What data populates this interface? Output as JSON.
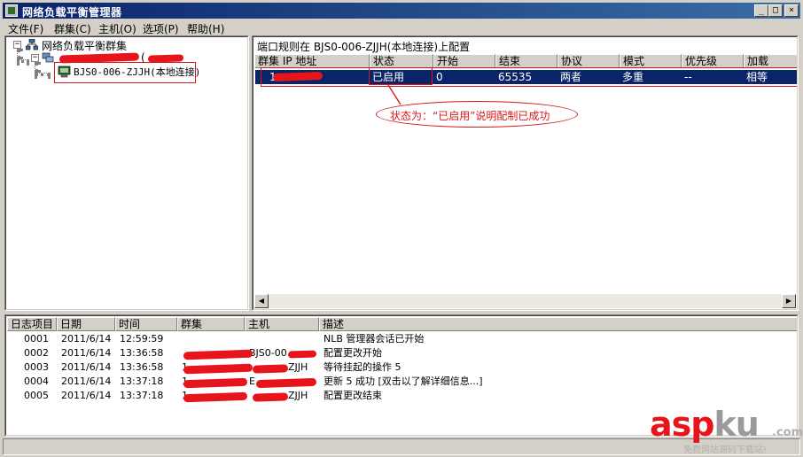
{
  "window": {
    "title": "网络负载平衡管理器",
    "controls": {
      "minimize": "_",
      "maximize": "□",
      "close": "×"
    }
  },
  "menu": [
    "文件(F)",
    "群集(C)",
    "主机(O)",
    "选项(P)",
    "帮助(H)"
  ],
  "tree": {
    "root_label": "网络负载平衡群集",
    "cluster_label_suffix": "(",
    "host_label": "BJS0-006-ZJJH(本地连接)",
    "icons": {
      "root": "network-clusters-icon",
      "cluster": "cluster-icon",
      "host": "host-computer-icon"
    }
  },
  "ports": {
    "caption": "端口规则在 BJS0-006-ZJJH(本地连接)上配置",
    "columns": [
      "群集 IP 地址",
      "状态",
      "开始",
      "结束",
      "协议",
      "模式",
      "优先级",
      "加载"
    ],
    "rows": [
      {
        "ip": "1",
        "status": "已启用",
        "start": "0",
        "end": "65535",
        "protocol": "两者",
        "mode": "多重",
        "priority": "--",
        "load": "相等"
      }
    ]
  },
  "annotation": {
    "text": "状态为：“已启用”说明配制已成功",
    "color": "#d81818"
  },
  "log": {
    "columns": [
      "日志项目",
      "日期",
      "时间",
      "群集",
      "主机",
      "描述"
    ],
    "rows": [
      {
        "id": "0001",
        "date": "2011/6/14",
        "time": "12:59:59",
        "cluster": "",
        "host": "",
        "desc": "NLB 管理器会话已开始"
      },
      {
        "id": "0002",
        "date": "2011/6/14",
        "time": "13:36:58",
        "cluster": "",
        "host": "BJS0-00",
        "desc": "配置更改开始"
      },
      {
        "id": "0003",
        "date": "2011/6/14",
        "time": "13:36:58",
        "cluster": "1",
        "host": "ZJJH",
        "desc": "等待挂起的操作 5"
      },
      {
        "id": "0004",
        "date": "2011/6/14",
        "time": "13:37:18",
        "cluster": "1",
        "host": "E",
        "desc": "更新 5 成功 [双击以了解详细信息...]"
      },
      {
        "id": "0005",
        "date": "2011/6/14",
        "time": "13:37:18",
        "cluster": "1",
        "host": "ZJJH",
        "desc": "配置更改结束"
      }
    ]
  },
  "watermark": {
    "brand_red": "asp",
    "brand_gray": "ku",
    "suffix": ".com",
    "tagline": "免费网站源码下载站!",
    "colors": {
      "red": "#e8141c",
      "gray": "#9a9a9a"
    }
  },
  "colors": {
    "titlebar": "#0a246a",
    "selection": "#0a246a",
    "face": "#d4d0c8",
    "redaction": "#e8141c"
  }
}
